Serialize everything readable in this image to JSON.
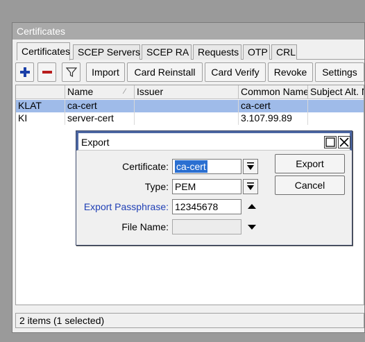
{
  "window": {
    "title": "Certificates",
    "tabs": [
      "Certificates",
      "SCEP Servers",
      "SCEP RA",
      "Requests",
      "OTP",
      "CRL"
    ],
    "toolbar": {
      "import_label": "Import",
      "card_reinstall_label": "Card Reinstall",
      "card_verify_label": "Card Verify",
      "revoke_label": "Revoke",
      "settings_label": "Settings"
    },
    "table": {
      "headers": [
        "Name",
        "Issuer",
        "Common Name",
        "Subject Alt. N"
      ],
      "rows": [
        {
          "flags": "KLAT",
          "name": "ca-cert",
          "issuer": "",
          "common_name": "ca-cert",
          "subject_alt": "",
          "selected": true
        },
        {
          "flags": "KI",
          "name": "server-cert",
          "issuer": "",
          "common_name": "3.107.99.89",
          "subject_alt": "",
          "selected": false
        }
      ]
    },
    "status": "2 items (1 selected)"
  },
  "dialog": {
    "title": "Export",
    "certificate_label": "Certificate:",
    "certificate_value": "ca-cert",
    "type_label": "Type:",
    "type_value": "PEM",
    "passphrase_label": "Export Passphrase:",
    "passphrase_value": "12345678",
    "filename_label": "File Name:",
    "filename_value": "",
    "export_button": "Export",
    "cancel_button": "Cancel"
  },
  "icons": [
    "add-icon",
    "remove-icon",
    "filter-icon",
    "dropdown-icon",
    "expand-up-icon",
    "expand-down-icon",
    "maximize-icon",
    "close-icon"
  ],
  "colors": {
    "selection": "#9fbbe9",
    "passphrase_label": "#1f3fb5",
    "add_icon": "#1a3fa8",
    "remove_icon": "#b81c1c"
  }
}
